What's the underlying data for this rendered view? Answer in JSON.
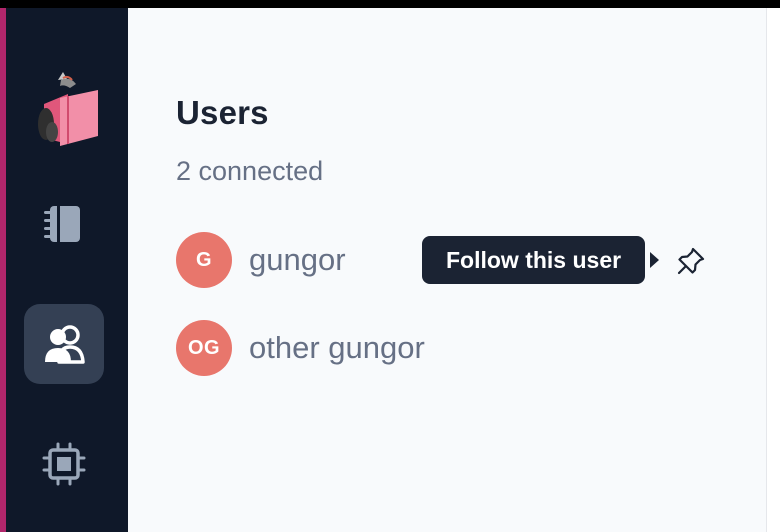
{
  "colors": {
    "sidebar_bg": "#0f1829",
    "accent_strip": "#b1266b",
    "active_item_bg": "#344054",
    "main_bg": "#f8fafc",
    "avatar_bg": "#e8766c",
    "tooltip_bg": "#1b2333"
  },
  "sidebar": {
    "logo_icon": "pink-book-mascot-logo",
    "items": [
      {
        "id": "notebook",
        "icon": "notebook-icon",
        "active": false
      },
      {
        "id": "users",
        "icon": "users-icon",
        "active": true
      },
      {
        "id": "hardware",
        "icon": "cpu-icon",
        "active": false
      }
    ]
  },
  "panel": {
    "title": "Users",
    "subtitle": "2 connected",
    "users": [
      {
        "initials": "G",
        "name": "gungor"
      },
      {
        "initials": "OG",
        "name": "other gungor"
      }
    ]
  },
  "tooltip": {
    "text": "Follow this user"
  },
  "actions": {
    "pin_icon": "pin-icon"
  }
}
